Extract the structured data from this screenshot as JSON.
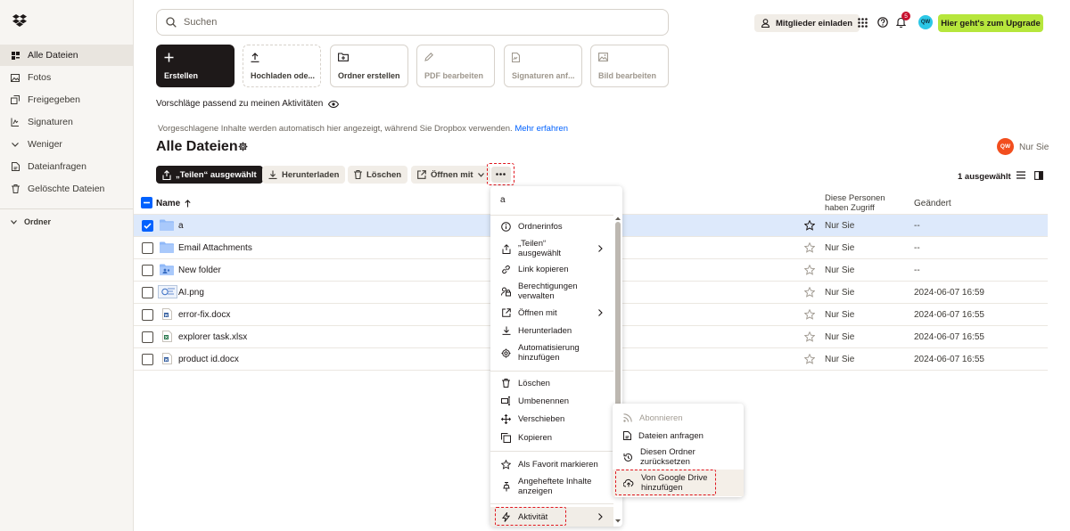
{
  "sidebar": {
    "items": [
      {
        "label": "Alle Dateien",
        "icon": "files-icon",
        "active": true
      },
      {
        "label": "Fotos",
        "icon": "photo-icon"
      },
      {
        "label": "Freigegeben",
        "icon": "shared-icon"
      },
      {
        "label": "Signaturen",
        "icon": "signature-icon"
      },
      {
        "label": "Weniger",
        "icon": "chevron-down-icon"
      },
      {
        "label": "Dateianfragen",
        "icon": "file-request-icon"
      },
      {
        "label": "Gelöschte Dateien",
        "icon": "trash-icon"
      }
    ],
    "section_label": "Ordner"
  },
  "header": {
    "search_placeholder": "Suchen",
    "invite_label": "Mitglieder einladen",
    "notification_count": "5",
    "user_initials": "QW",
    "upgrade_label": "Hier geht's zum Upgrade"
  },
  "tiles": [
    {
      "label": "Erstellen",
      "icon": "plus-icon",
      "style": "primary"
    },
    {
      "label": "Hochladen ode...",
      "icon": "upload-icon",
      "style": "dashed"
    },
    {
      "label": "Ordner erstellen",
      "icon": "folder-plus-icon"
    },
    {
      "label": "PDF bearbeiten",
      "icon": "pen-icon",
      "style": "disabled"
    },
    {
      "label": "Signaturen anf...",
      "icon": "signature-request-icon",
      "style": "disabled"
    },
    {
      "label": "Bild bearbeiten",
      "icon": "image-icon",
      "style": "disabled"
    }
  ],
  "suggestions": {
    "title": "Vorschläge passend zu meinen Aktivitäten",
    "description": "Vorgeschlagene Inhalte werden automatisch hier angezeigt, während Sie Dropbox verwenden.",
    "learn_more": "Mehr erfahren"
  },
  "page": {
    "title": "Alle Dateien",
    "owner_initials": "QW",
    "owner_text": "Nur Sie"
  },
  "toolbar": {
    "share_label": "„Teilen“ ausgewählt",
    "download_label": "Herunterladen",
    "delete_label": "Löschen",
    "open_with_label": "Öffnen mit",
    "selected_count": "1 ausgewählt"
  },
  "table": {
    "col_name": "Name",
    "col_access_line1": "Diese Personen",
    "col_access_line2": "haben Zugriff",
    "col_changed": "Geändert",
    "rows": [
      {
        "name": "a",
        "type": "folder",
        "access": "Nur Sie",
        "changed": "--",
        "selected": true
      },
      {
        "name": "Email Attachments",
        "type": "folder",
        "access": "Nur Sie",
        "changed": "--"
      },
      {
        "name": "New folder",
        "type": "shared-folder",
        "access": "Nur Sie",
        "changed": "--"
      },
      {
        "name": "AI.png",
        "type": "image",
        "access": "Nur Sie",
        "changed": "2024-06-07 16:59"
      },
      {
        "name": "error-fix.docx",
        "type": "word",
        "access": "Nur Sie",
        "changed": "2024-06-07 16:55"
      },
      {
        "name": "explorer task.xlsx",
        "type": "excel",
        "access": "Nur Sie",
        "changed": "2024-06-07 16:55"
      },
      {
        "name": "product id.docx",
        "type": "word",
        "access": "Nur Sie",
        "changed": "2024-06-07 16:55"
      }
    ]
  },
  "context_menu": {
    "header": "a",
    "items": [
      {
        "label": "Ordnerinfos",
        "icon": "info-icon"
      },
      {
        "label": "„Teilen“ ausgewählt",
        "icon": "share-icon",
        "submenu": true
      },
      {
        "label": "Link kopieren",
        "icon": "link-icon"
      },
      {
        "label": "Berechtigungen verwalten",
        "icon": "permissions-icon"
      },
      {
        "label": "Öffnen mit",
        "icon": "open-external-icon",
        "submenu": true
      },
      {
        "label": "Herunterladen",
        "icon": "download-icon"
      },
      {
        "label": "Automatisierung hinzufügen",
        "icon": "automation-icon"
      },
      {
        "label": "Löschen",
        "icon": "trash-icon"
      },
      {
        "label": "Umbenennen",
        "icon": "rename-icon"
      },
      {
        "label": "Verschieben",
        "icon": "move-icon"
      },
      {
        "label": "Kopieren",
        "icon": "copy-icon"
      },
      {
        "label": "Als Favorit markieren",
        "icon": "star-icon"
      },
      {
        "label": "Angeheftete Inhalte anzeigen",
        "icon": "pin-icon"
      },
      {
        "label": "Aktivität",
        "icon": "activity-icon",
        "submenu": true
      }
    ]
  },
  "submenu": {
    "items": [
      {
        "label": "Abonnieren",
        "icon": "rss-icon",
        "disabled": true
      },
      {
        "label": "Dateien anfragen",
        "icon": "file-request-icon"
      },
      {
        "label": "Diesen Ordner zurücksetzen",
        "icon": "restore-icon"
      },
      {
        "label": "Von Google Drive hinzufügen",
        "icon": "cloud-upload-icon",
        "highlighted": true
      }
    ]
  },
  "colors": {
    "accent": "#0061fe",
    "upgrade": "#b6e63c",
    "annotation": "#e0161e"
  }
}
